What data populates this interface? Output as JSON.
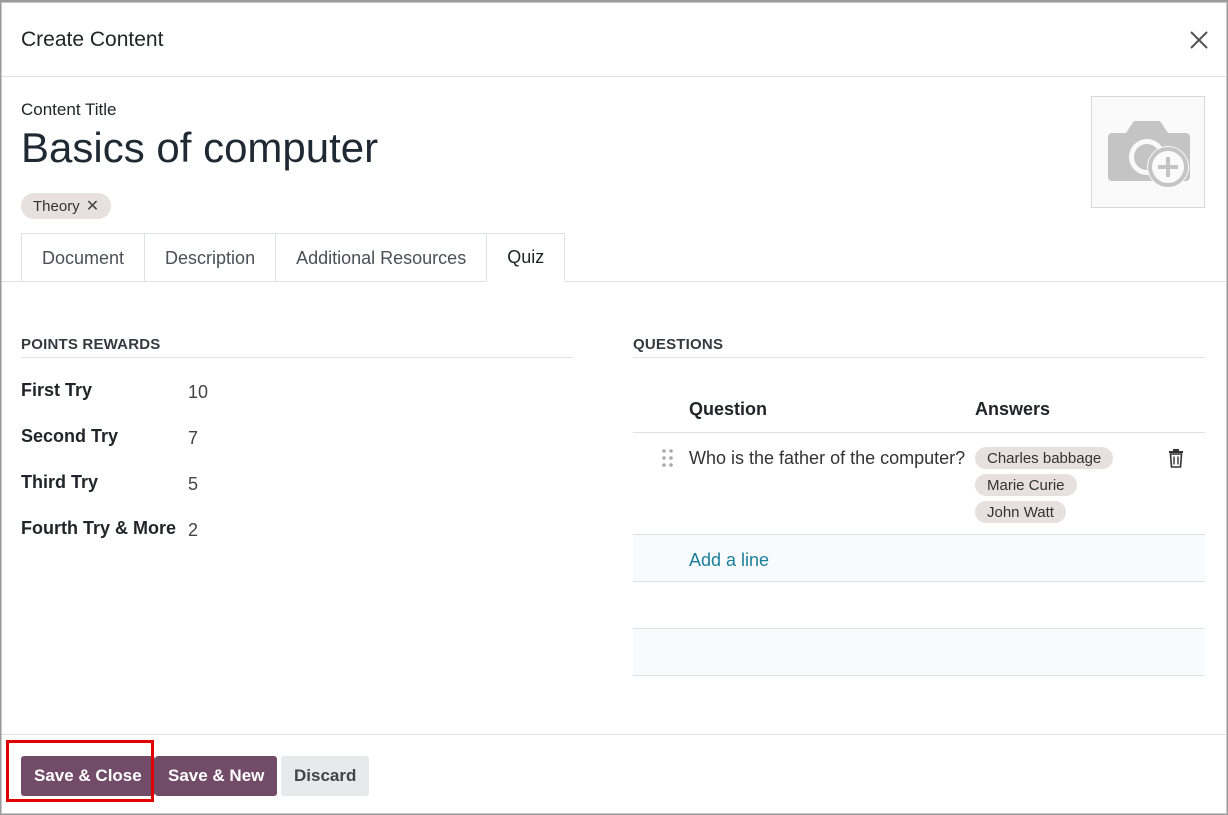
{
  "modal": {
    "title": "Create Content",
    "close_icon": "close-icon"
  },
  "content": {
    "title_label": "Content Title",
    "title_value": "Basics of computer",
    "image_icon": "camera-add-icon",
    "tags": [
      {
        "label": "Theory",
        "remove": "✕"
      }
    ]
  },
  "tabs": [
    {
      "label": "Document",
      "active": false
    },
    {
      "label": "Description",
      "active": false
    },
    {
      "label": "Additional Resources",
      "active": false
    },
    {
      "label": "Quiz",
      "active": true
    }
  ],
  "points_rewards": {
    "heading": "POINTS REWARDS",
    "rows": [
      {
        "label": "First Try",
        "value": "10"
      },
      {
        "label": "Second Try",
        "value": "7"
      },
      {
        "label": "Third Try",
        "value": "5"
      },
      {
        "label": "Fourth Try & More",
        "value": "2"
      }
    ]
  },
  "questions": {
    "heading": "QUESTIONS",
    "columns": {
      "question": "Question",
      "answers": "Answers"
    },
    "rows": [
      {
        "question": "Who is the father of the computer?",
        "answers": [
          "Charles babbage",
          "Marie Curie",
          "John Watt"
        ]
      }
    ],
    "add_line": "Add a line"
  },
  "footer": {
    "save_close": "Save & Close",
    "save_new": "Save & New",
    "discard": "Discard"
  },
  "colors": {
    "primary": "#714b67",
    "highlight": "#e00000",
    "link": "#1a7f9c"
  }
}
